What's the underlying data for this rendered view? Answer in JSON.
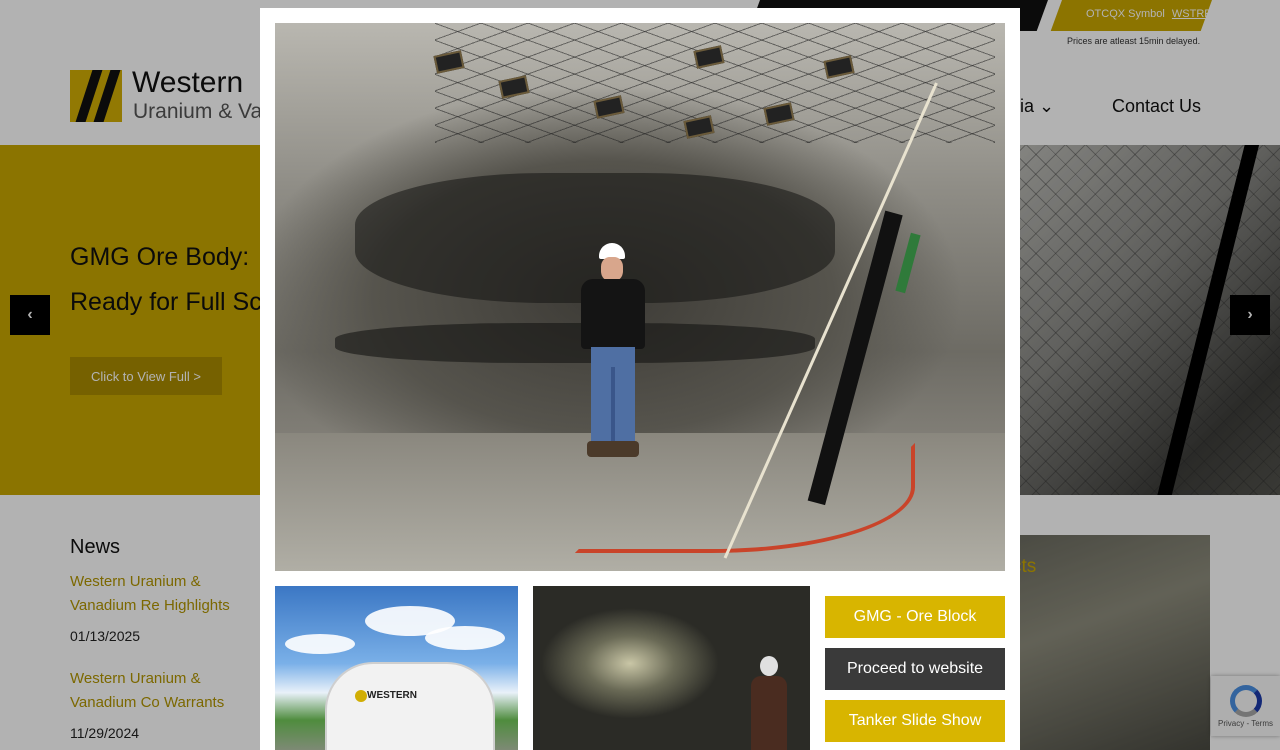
{
  "ticker": {
    "label": "OTCQX Symbol",
    "symbol": "WSTRF",
    "note": "Prices are atleast 15min delayed."
  },
  "logo": {
    "line1": "Western",
    "line2": "Uranium & Vanadium"
  },
  "nav": {
    "media_partial": "dia",
    "contact": "Contact Us"
  },
  "hero": {
    "title_line1": "GMG Ore Body:",
    "title_line2": "Ready for Full Scale F",
    "button": "Click to View Full >",
    "prev": "‹",
    "next": "›"
  },
  "news": {
    "heading": "News",
    "items": [
      {
        "title": "Western Uranium & Vanadium Re Highlights",
        "date": "01/13/2025"
      },
      {
        "title": "Western Uranium & Vanadium Co Warrants",
        "date": "11/29/2024"
      }
    ]
  },
  "projects": {
    "label_partial": "cts"
  },
  "recaptcha": {
    "text": "Privacy - Terms"
  },
  "modal": {
    "thumb1_logo": "WESTERN",
    "buttons": [
      {
        "label": "GMG - Ore Block",
        "style": "gold"
      },
      {
        "label": "Proceed to website",
        "style": "dark"
      },
      {
        "label": "Tanker Slide Show",
        "style": "gold"
      }
    ]
  },
  "colors": {
    "brand_gold": "#c8a601",
    "button_gold": "#d8b500",
    "button_dark": "#3a3a3a"
  }
}
